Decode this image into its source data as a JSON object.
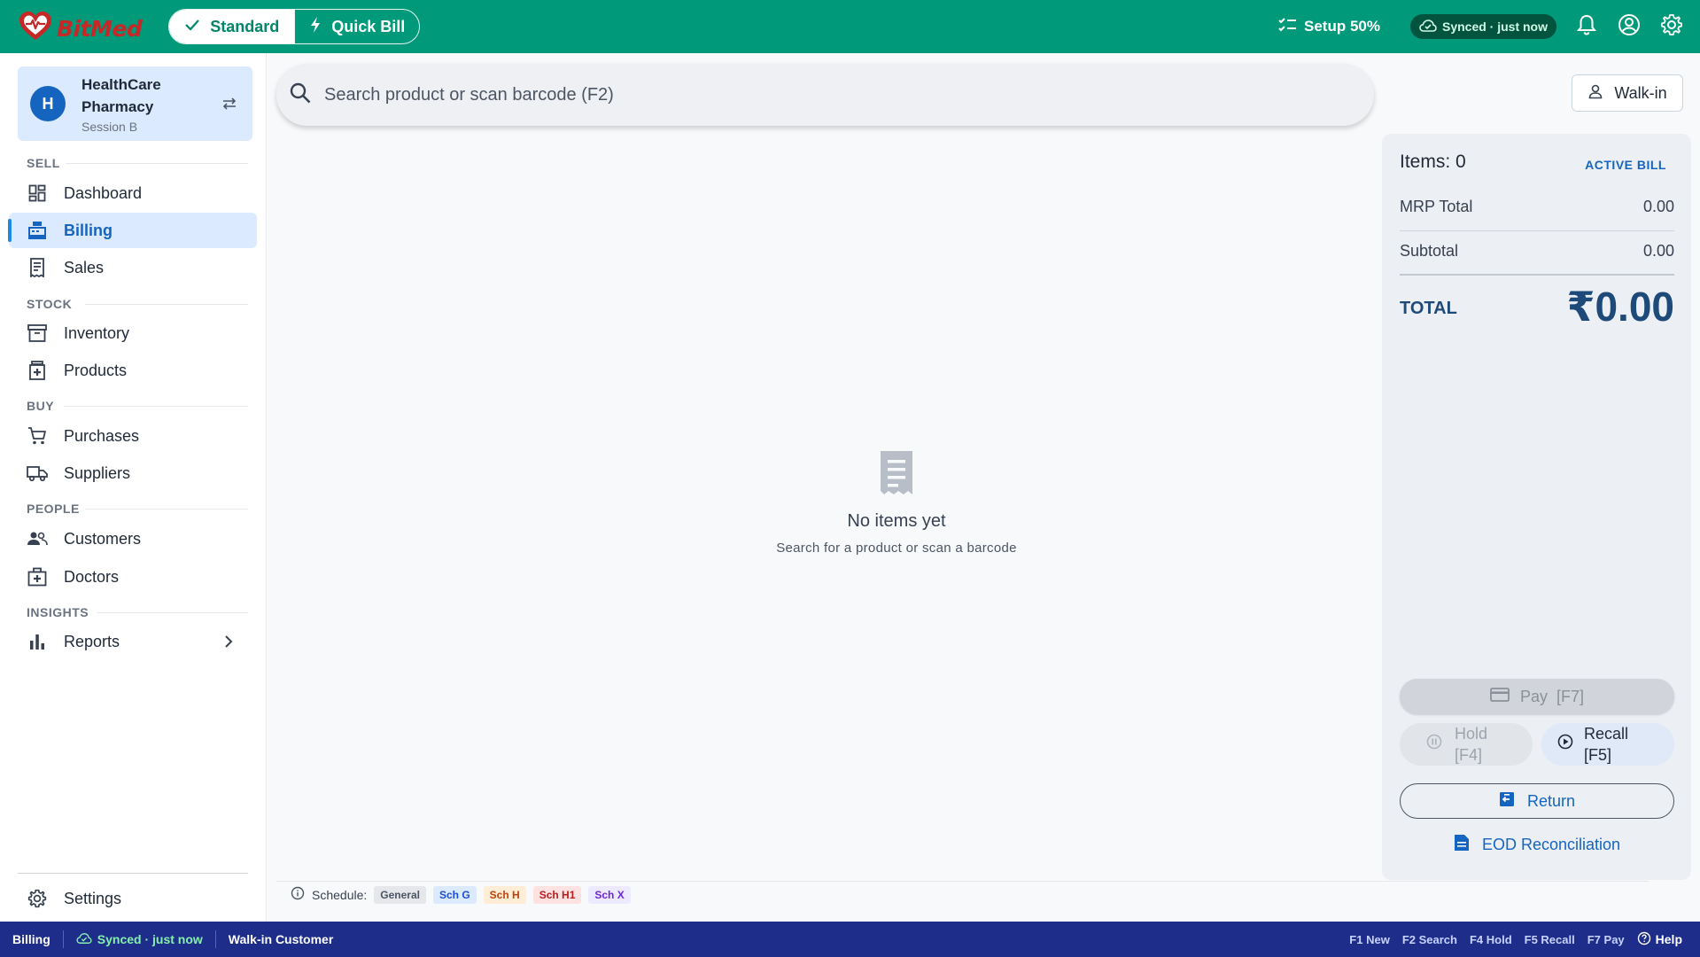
{
  "app": {
    "brand": "BitMed",
    "brand_color": "#c62828",
    "accent": "#00997a"
  },
  "topbar": {
    "mode_standard": "Standard",
    "mode_quick": "Quick Bill",
    "setup": "Setup 50%",
    "synced": "Synced · just now"
  },
  "store": {
    "initial": "H",
    "name": "HealthCare Pharmacy",
    "session": "Session B"
  },
  "sidebar": {
    "sections": {
      "sell": "SELL",
      "stock": "STOCK",
      "buy": "BUY",
      "people": "PEOPLE",
      "insights": "INSIGHTS"
    },
    "items": {
      "dashboard": "Dashboard",
      "billing": "Billing",
      "sales": "Sales",
      "inventory": "Inventory",
      "products": "Products",
      "purchases": "Purchases",
      "suppliers": "Suppliers",
      "customers": "Customers",
      "doctors": "Doctors",
      "reports": "Reports",
      "settings": "Settings"
    },
    "active": "billing"
  },
  "search": {
    "placeholder": "Search product or scan barcode (F2)"
  },
  "walkin_button": "Walk-in",
  "empty_state": {
    "title": "No items yet",
    "subtitle": "Search for a product or scan a barcode"
  },
  "bill": {
    "items_count": "Items: 0",
    "badge": "ACTIVE BILL",
    "mrp_total_label": "MRP Total",
    "mrp_total_value": "0.00",
    "subtotal_label": "Subtotal",
    "subtotal_value": "0.00",
    "total_label": "TOTAL",
    "total_value": "₹0.00",
    "pay": "Pay  [F7]",
    "hold_line1": "Hold",
    "hold_line2": "[F4]",
    "recall_line1": "Recall",
    "recall_line2": "[F5]",
    "return": "Return",
    "eod": "EOD Reconciliation"
  },
  "schedule": {
    "label": "Schedule:",
    "tags": [
      {
        "text": "General",
        "bg": "#e5e7eb",
        "fg": "#4b5563"
      },
      {
        "text": "Sch G",
        "bg": "#dbeafe",
        "fg": "#1d4ed8"
      },
      {
        "text": "Sch H",
        "bg": "#ffedd5",
        "fg": "#c2410c"
      },
      {
        "text": "Sch H1",
        "bg": "#fee2e2",
        "fg": "#b91c1c"
      },
      {
        "text": "Sch X",
        "bg": "#ede9fe",
        "fg": "#6d28d9"
      }
    ]
  },
  "statusbar": {
    "page": "Billing",
    "synced": "Synced · just now",
    "customer": "Walk-in Customer",
    "shortcuts": [
      "F1 New",
      "F2 Search",
      "F4 Hold",
      "F5 Recall",
      "F7 Pay"
    ],
    "help": "Help"
  }
}
